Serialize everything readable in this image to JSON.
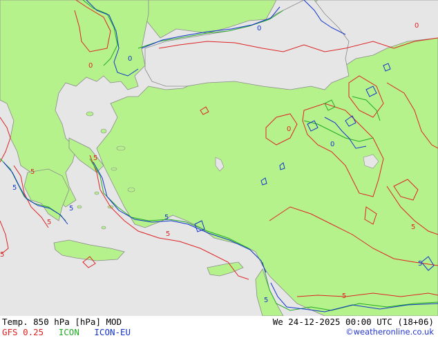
{
  "title": "Temp. 850 hPa [hPa] MOD",
  "valid_time": "We 24-12-2025 00:00 UTC (18+06)",
  "credit": "©weatheronline.co.uk",
  "models": [
    {
      "label": "GFS 0.25",
      "color": "#dd2222"
    },
    {
      "label": "ICON",
      "color": "#22aa22"
    },
    {
      "label": "ICON-EU",
      "color": "#1133cc"
    }
  ],
  "contour_labels": [
    {
      "text": "5",
      "color": "#dd2222"
    },
    {
      "text": "5",
      "color": "#1133cc"
    },
    {
      "text": "0",
      "color": "#dd2222"
    },
    {
      "text": "0",
      "color": "#1133cc"
    }
  ],
  "colors": {
    "land": "#b6f28c",
    "sea": "#e6e6e6",
    "coast": "#8a8a8a",
    "gfs": "#dd2222",
    "icon": "#22aa22",
    "icon_eu": "#1133cc"
  }
}
